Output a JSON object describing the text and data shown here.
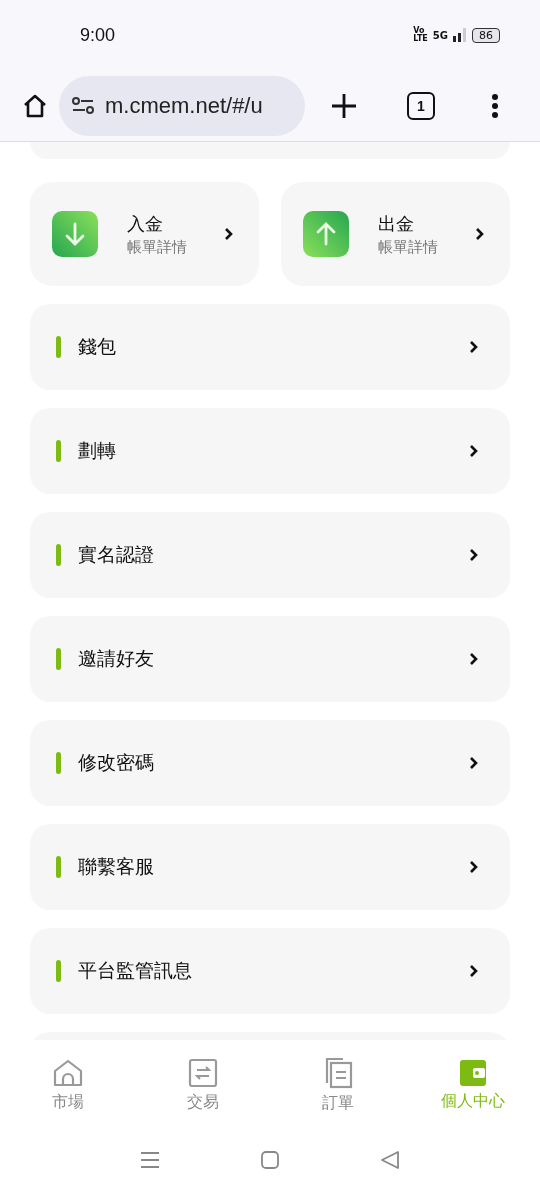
{
  "status_bar": {
    "time": "9:00",
    "volte_top": "Vo",
    "volte_bottom": "LTE",
    "network": "5G",
    "battery": "86"
  },
  "browser": {
    "url": "m.cmem.net/#/u",
    "tab_count": "1"
  },
  "quick_cards": [
    {
      "kind": "deposit",
      "title": "入金",
      "subtitle": "帳單詳情"
    },
    {
      "kind": "withdraw",
      "title": "出金",
      "subtitle": "帳單詳情"
    }
  ],
  "menu_items": [
    {
      "label": "錢包"
    },
    {
      "label": "劃轉"
    },
    {
      "label": "實名認證"
    },
    {
      "label": "邀請好友"
    },
    {
      "label": "修改密碼"
    },
    {
      "label": "聯繫客服"
    },
    {
      "label": "平台監管訊息"
    }
  ],
  "bottom_nav": [
    {
      "kind": "market",
      "label": "市場",
      "selected": false
    },
    {
      "kind": "trade",
      "label": "交易",
      "selected": false
    },
    {
      "kind": "orders",
      "label": "訂單",
      "selected": false
    },
    {
      "kind": "profile",
      "label": "個人中心",
      "selected": true
    }
  ]
}
